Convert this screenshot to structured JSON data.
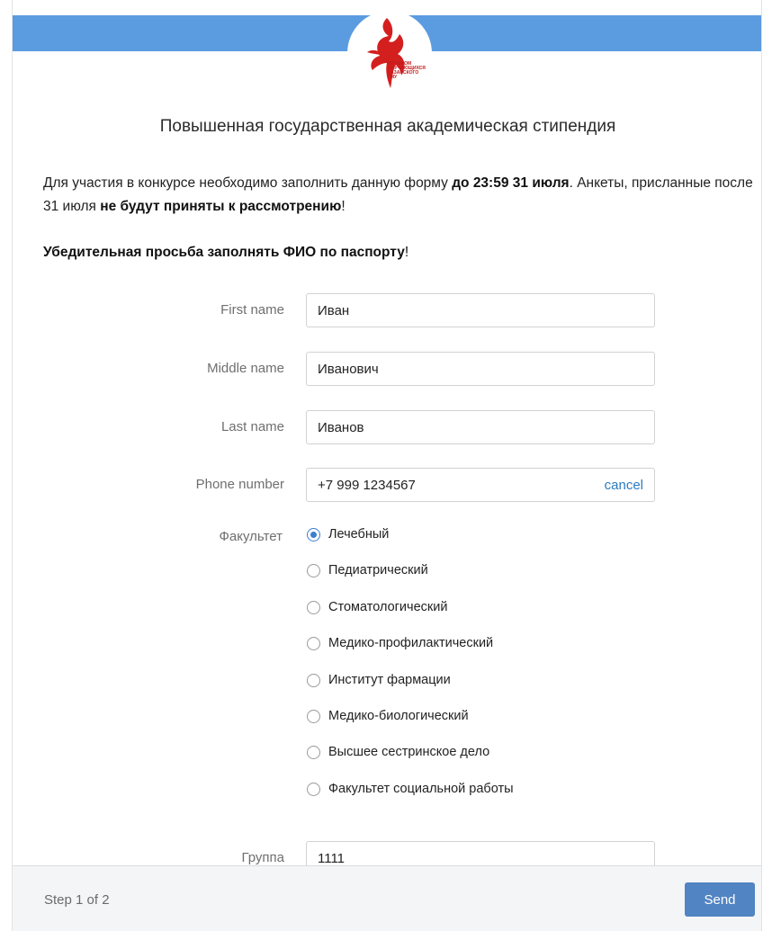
{
  "logo": {
    "text": "ПРОФКОМ ОБУЧАЮЩИХСЯ КАЗАНСКОГО ГМУ"
  },
  "form": {
    "title": "Повышенная государственная академическая стипендия",
    "intro": {
      "p1": "Для участия в конкурсе необходимо заполнить данную форму ",
      "p1_bold": "до 23:59 31 июля",
      "p2": ". Анкеты, присланные после 31 июля ",
      "p2_bold": "не будут приняты к рассмотрению",
      "p3": "!"
    },
    "notice_bold": "Убедительная просьба заполнять ФИО по паспорту",
    "notice_end": "!",
    "fields": {
      "first_name": {
        "label": "First name",
        "value": "Иван"
      },
      "middle_name": {
        "label": "Middle name",
        "value": "Иванович"
      },
      "last_name": {
        "label": "Last name",
        "value": "Иванов"
      },
      "phone": {
        "label": "Phone number",
        "value": "+7 999 1234567",
        "cancel": "cancel"
      },
      "group": {
        "label": "Группа",
        "value": "1111"
      }
    },
    "faculty": {
      "label": "Факультет",
      "options": [
        "Лечебный",
        "Педиатрический",
        "Стоматологический",
        "Медико-профилактический",
        "Институт фармации",
        "Медико-биологический",
        "Высшее сестринское дело",
        "Факультет социальной работы"
      ],
      "selected": "Лечебный"
    }
  },
  "footer": {
    "step": "Step 1 of 2",
    "send": "Send"
  },
  "colors": {
    "header": "#5b9be0",
    "accent": "#5184c2",
    "link": "#2d7bbf"
  }
}
